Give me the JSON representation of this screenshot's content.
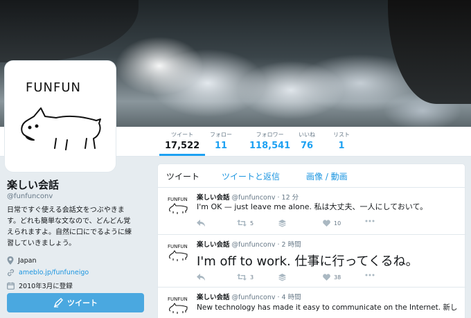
{
  "profile": {
    "name": "楽しい会話",
    "handle": "@funfunconv",
    "bio_lines": [
      "日常ですぐ使える会話文をつぶやきま",
      "す。どれも簡単な文なので、どんどん覚",
      "えられますよ。自然に口にでるように練",
      "習していきましょう。"
    ],
    "location": "Japan",
    "url": "ameblo.jp/funfuneigo",
    "joined": "2010年3月に登録",
    "tweet_button": "ツイート",
    "avatar_logo_text": "FUNFUN"
  },
  "stats": [
    {
      "label": "ツイート",
      "value": "17,522"
    },
    {
      "label": "フォロー",
      "value": "11"
    },
    {
      "label": "フォロワー",
      "value": "118,541"
    },
    {
      "label": "いいね",
      "value": "76"
    },
    {
      "label": "リスト",
      "value": "1"
    }
  ],
  "tabs": [
    "ツイート",
    "ツイートと返信",
    "画像 / 動画"
  ],
  "tweets": [
    {
      "name": "楽しい会話",
      "meta": "@funfunconv · 12 分",
      "text": "I'm OK — just leave me alone. 私は大丈夫、一人にしておいて。",
      "retweets": "5",
      "likes": "10",
      "logo": "FUNFUN"
    },
    {
      "name": "楽しい会話",
      "meta": "@funfunconv · 2 時間",
      "text": "I'm off to work. 仕事に行ってくるね。",
      "retweets": "3",
      "likes": "38",
      "logo": "FUNFUN"
    },
    {
      "name": "楽しい会話",
      "meta": "@funfunconv · 4 時間",
      "text": "New technology has made it easy to communicate on the Internet. 新し",
      "logo": "FUNFUN"
    }
  ],
  "colors": {
    "accent": "#1da1f2",
    "link": "#1b95e0",
    "muted": "#657786",
    "icon": "#aab8c2"
  }
}
